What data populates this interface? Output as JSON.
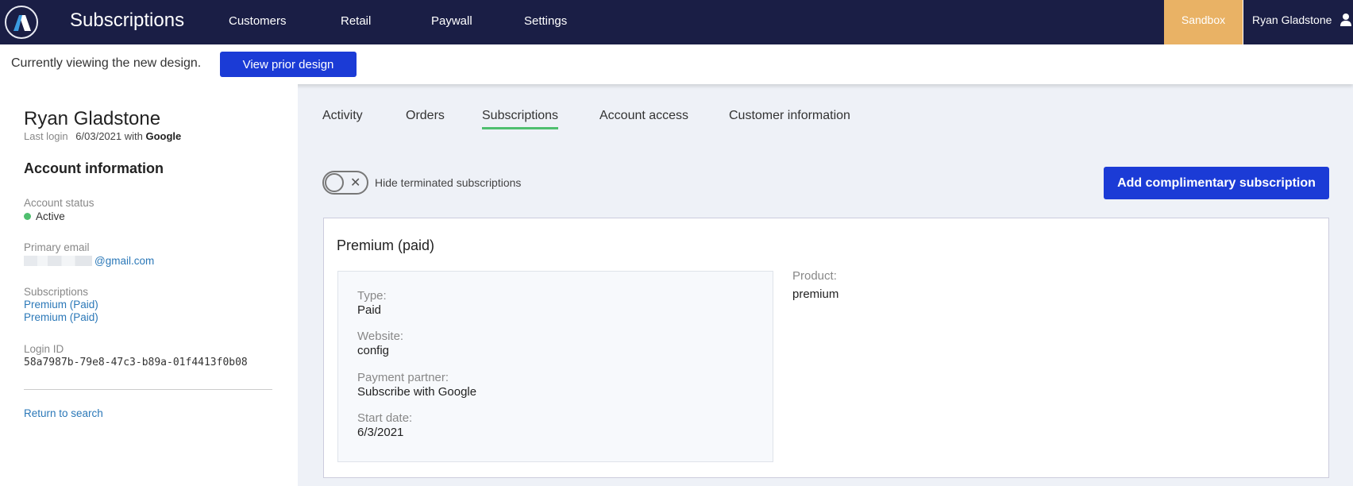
{
  "header": {
    "logo_icon": "app-logo-icon",
    "app_title": "Subscriptions",
    "nav": [
      "Customers",
      "Retail",
      "Paywall",
      "Settings"
    ],
    "environment_badge": "Sandbox",
    "user_name": "Ryan Gladstone",
    "user_icon": "user-icon",
    "colors": {
      "topbar": "#1a1e45",
      "sandbox": "#e9b265",
      "primary_button": "#1b3bd6",
      "active_tab": "#4fbf6f"
    }
  },
  "notice": {
    "text": "Currently viewing the new design.",
    "button_label": "View prior design"
  },
  "sidebar": {
    "customer_name": "Ryan Gladstone",
    "last_login_label": "Last login",
    "last_login_date": "6/03/2021 with",
    "last_login_provider": "Google",
    "section_title": "Account information",
    "account_status_label": "Account status",
    "account_status_value": "Active",
    "primary_email_label": "Primary email",
    "primary_email_value": "@gmail.com",
    "subscriptions_label": "Subscriptions",
    "subscriptions": [
      "Premium (Paid)",
      "Premium (Paid)"
    ],
    "login_id_label": "Login ID",
    "login_id_value": "58a7987b-79e8-47c3-b89a-01f4413f0b08",
    "return_link": "Return to search"
  },
  "main": {
    "tabs": [
      {
        "label": "Activity",
        "active": false
      },
      {
        "label": "Orders",
        "active": false
      },
      {
        "label": "Subscriptions",
        "active": true
      },
      {
        "label": "Account access",
        "active": false
      },
      {
        "label": "Customer information",
        "active": false
      }
    ],
    "toggle_label": "Hide terminated subscriptions",
    "toggle_on": false,
    "add_button_label": "Add complimentary subscription",
    "subscription_card": {
      "title": "Premium (paid)",
      "fields": [
        {
          "label": "Type:",
          "value": "Paid"
        },
        {
          "label": "Website:",
          "value": "config"
        },
        {
          "label": "Payment partner:",
          "value": "Subscribe with Google"
        },
        {
          "label": "Start date:",
          "value": "6/3/2021"
        }
      ],
      "product_label": "Product:",
      "product_value": "premium"
    }
  }
}
